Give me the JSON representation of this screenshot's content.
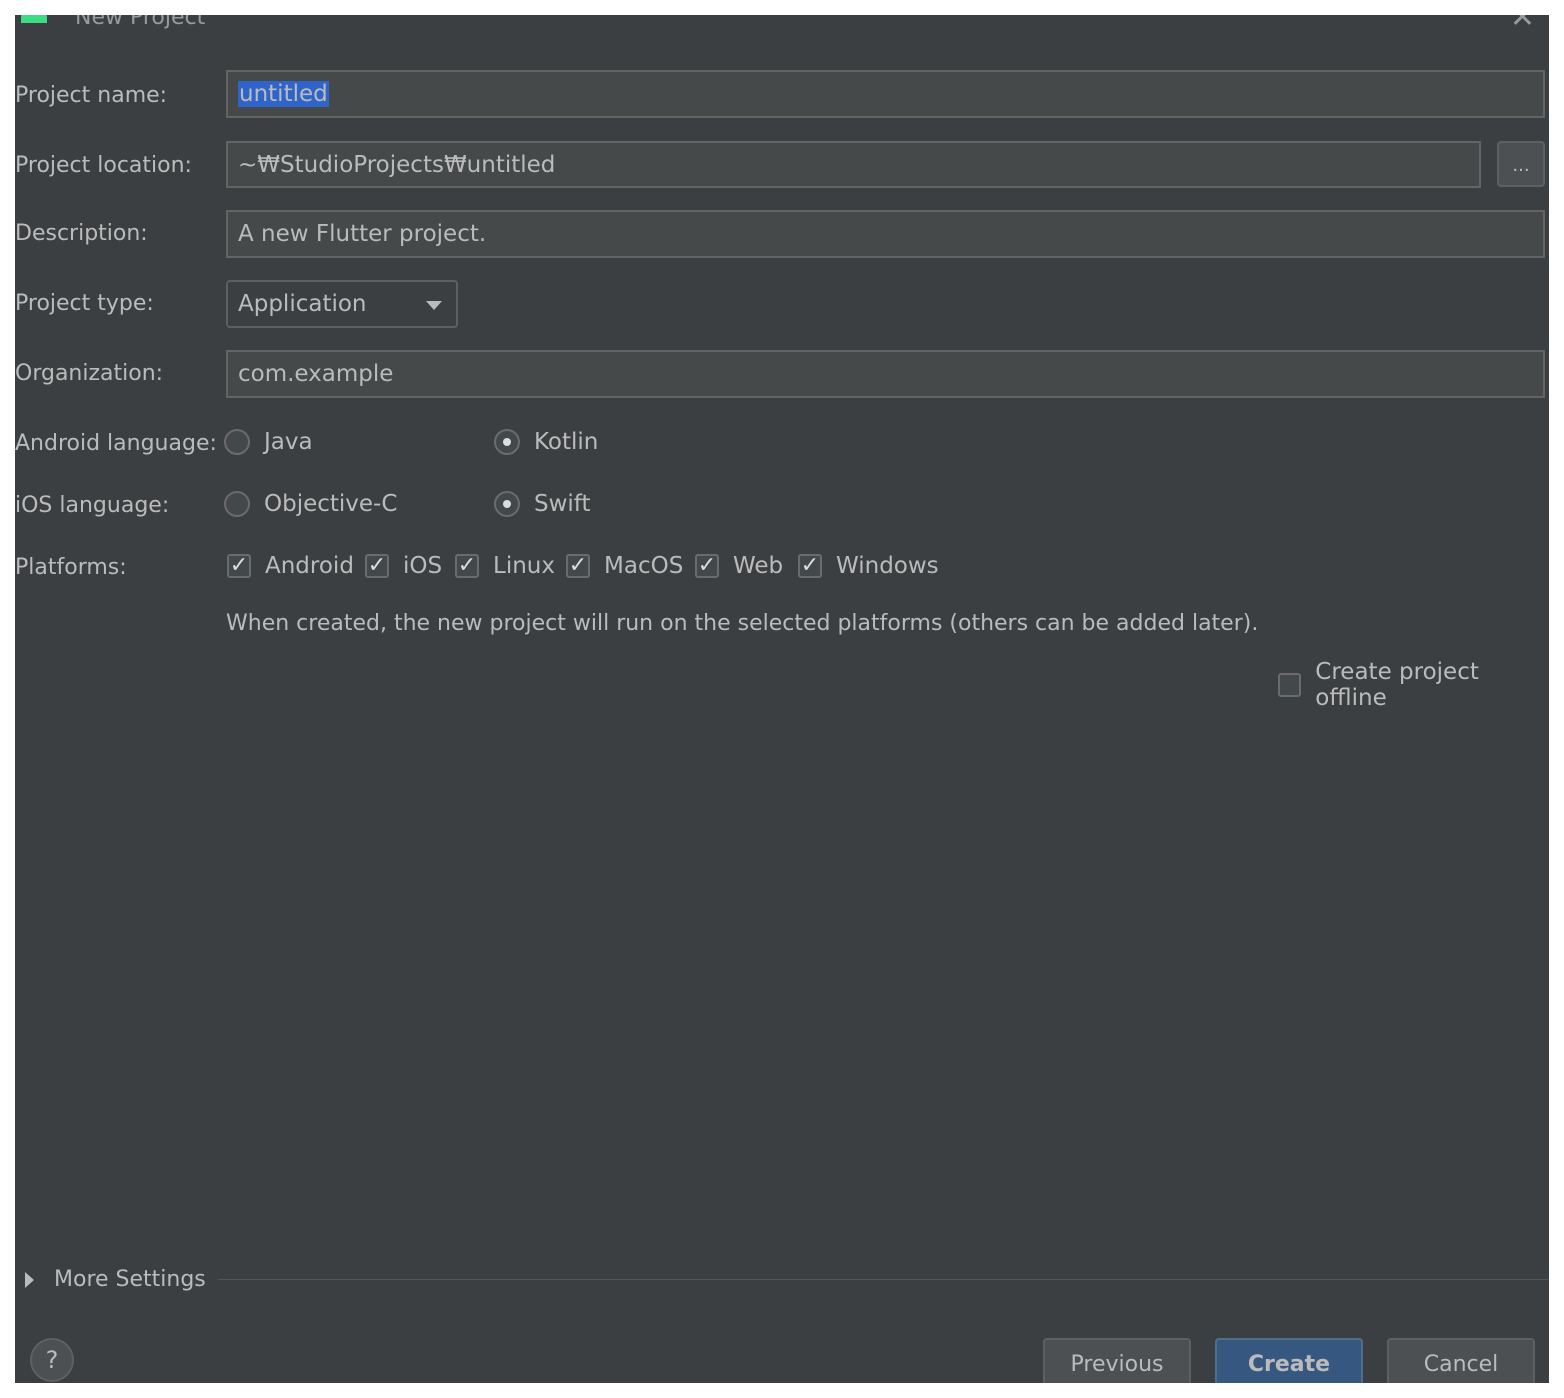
{
  "window": {
    "title": "New Project",
    "app_icon": "android-icon",
    "close_icon": "close-icon"
  },
  "form": {
    "project_name": {
      "label": "Project name:",
      "value": "untitled"
    },
    "project_location": {
      "label": "Project location:",
      "value": "~₩StudioProjects₩untitled",
      "browse_label": "..."
    },
    "description": {
      "label": "Description:",
      "value": "A new Flutter project."
    },
    "project_type": {
      "label": "Project type:",
      "selected": "Application"
    },
    "organization": {
      "label": "Organization:",
      "value": "com.example"
    },
    "android_language": {
      "label": "Android language:",
      "options": [
        {
          "label": "Java",
          "selected": false
        },
        {
          "label": "Kotlin",
          "selected": true
        }
      ]
    },
    "ios_language": {
      "label": "iOS language:",
      "options": [
        {
          "label": "Objective-C",
          "selected": false
        },
        {
          "label": "Swift",
          "selected": true
        }
      ]
    },
    "platforms": {
      "label": "Platforms:",
      "items": [
        {
          "label": "Android",
          "checked": true
        },
        {
          "label": "iOS",
          "checked": true
        },
        {
          "label": "Linux",
          "checked": true
        },
        {
          "label": "MacOS",
          "checked": true
        },
        {
          "label": "Web",
          "checked": true
        },
        {
          "label": "Windows",
          "checked": true
        }
      ],
      "hint": "When created, the new project will run on the selected platforms (others can be added later)."
    },
    "offline": {
      "label": "Create project offline",
      "checked": false
    }
  },
  "more_settings": {
    "label": "More Settings"
  },
  "footer": {
    "help_label": "?",
    "previous_label": "Previous",
    "create_label": "Create",
    "cancel_label": "Cancel"
  },
  "colors": {
    "background": "#3c3f41",
    "field": "#45494a",
    "selection": "#2f65ca",
    "primary_button": "#365880",
    "android_green": "#3ddc84"
  }
}
